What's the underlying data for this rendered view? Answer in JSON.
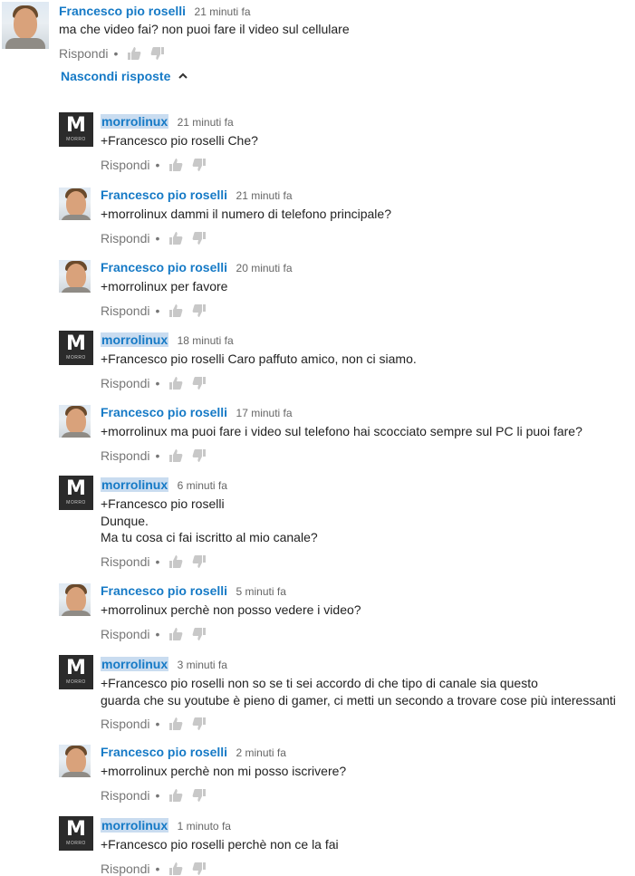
{
  "top_comment": {
    "author": "Francesco pio roselli",
    "time": "21 minuti fa",
    "text": "ma che video fai? non puoi fare il video sul cellulare",
    "reply_label": "Rispondi",
    "dot": "•"
  },
  "hide_replies_label": "Nascondi risposte",
  "icons": {
    "like": "thumbs-up-icon",
    "dislike": "thumbs-down-icon",
    "chevron": "chevron-up-icon"
  },
  "colors": {
    "author": "#167ac6",
    "meta": "#767676",
    "highlight": "#c9dcf0"
  },
  "avatar_logo": {
    "letter": "M",
    "caption": "MORRO"
  },
  "replies": [
    {
      "author": "morrolinux",
      "time": "21 minuti fa",
      "text": "+Francesco pio roselli Che?",
      "reply_label": "Rispondi",
      "dot": "•"
    },
    {
      "author": "Francesco pio roselli",
      "time": "21 minuti fa",
      "text": "+morrolinux dammi il numero di telefono principale?",
      "reply_label": "Rispondi",
      "dot": "•"
    },
    {
      "author": "Francesco pio roselli",
      "time": "20 minuti fa",
      "text": "+morrolinux per favore",
      "reply_label": "Rispondi",
      "dot": "•"
    },
    {
      "author": "morrolinux",
      "time": "18 minuti fa",
      "text": "+Francesco pio roselli Caro paffuto amico, non ci siamo.",
      "reply_label": "Rispondi",
      "dot": "•"
    },
    {
      "author": "Francesco pio roselli",
      "time": "17 minuti fa",
      "text": "+morrolinux ma puoi fare i video sul telefono hai scocciato sempre sul PC li puoi fare?",
      "reply_label": "Rispondi",
      "dot": "•"
    },
    {
      "author": "morrolinux",
      "time": "6 minuti fa",
      "text": "+Francesco pio roselli\nDunque.\nMa tu cosa ci fai iscritto al mio canale?",
      "reply_label": "Rispondi",
      "dot": "•"
    },
    {
      "author": "Francesco pio roselli",
      "time": "5 minuti fa",
      "text": "+morrolinux perchè non posso vedere i video?",
      "reply_label": "Rispondi",
      "dot": "•"
    },
    {
      "author": "morrolinux",
      "time": "3 minuti fa",
      "text": "+Francesco pio roselli non so se ti sei accordo di che tipo di canale sia questo\nguarda che su youtube è pieno di gamer, ci metti un secondo a trovare cose più interessanti",
      "reply_label": "Rispondi",
      "dot": "•"
    },
    {
      "author": "Francesco pio roselli",
      "time": "2 minuti fa",
      "text": "+morrolinux perchè non mi posso iscrivere?",
      "reply_label": "Rispondi",
      "dot": "•"
    },
    {
      "author": "morrolinux",
      "time": "1 minuto fa",
      "text": "+Francesco pio roselli perchè non ce la fai",
      "reply_label": "Rispondi",
      "dot": "•"
    }
  ]
}
